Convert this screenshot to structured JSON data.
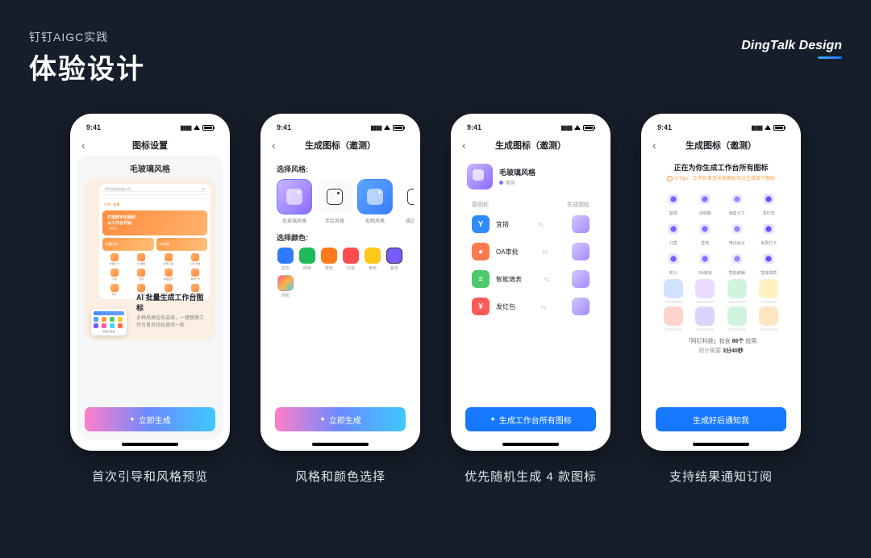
{
  "header": {
    "sub": "钉钉AIGC实践",
    "title": "体验设计"
  },
  "brand": {
    "name": "DingTalk Design"
  },
  "status_time": "9:41",
  "phone1": {
    "nav_title": "图标设置",
    "style_name": "毛玻璃风格",
    "company": "阿钉科技有限公司",
    "banner_line1": "打造数字化组织",
    "banner_line2": "从工作台开始",
    "banner_cta": "了解更多",
    "card_a": "专属红包",
    "card_b": "OA审批",
    "grid_items": [
      "考勤打卡",
      "OA审批",
      "智能人事",
      "钉钉文档",
      "订餐",
      "签到",
      "电话会议",
      "考勤打卡",
      "积分",
      "OA审批",
      "智能填报",
      "智能薪酬"
    ],
    "small_preview_label": "标准工作台",
    "info_title": "AI 批量生成工作台图标",
    "info_desc": "多种风格任你选择，一键替换工作台首页轻松焕然一新",
    "cta": "立即生成"
  },
  "phone2": {
    "nav_title": "生成图标（邀测）",
    "sec_style": "选择风格:",
    "styles": [
      {
        "name": "毛玻璃风格",
        "selected": true
      },
      {
        "name": "手绘风格"
      },
      {
        "name": "拟物风格"
      },
      {
        "name": "描边风格"
      }
    ],
    "sec_color": "选择颜色:",
    "colors": [
      {
        "name": "蓝色",
        "hex": "#2f7bff"
      },
      {
        "name": "绿色",
        "hex": "#1fba5a"
      },
      {
        "name": "橙色",
        "hex": "#ff7a1a"
      },
      {
        "name": "红色",
        "hex": "#ff4d4f"
      },
      {
        "name": "黄色",
        "hex": "#ffc718"
      },
      {
        "name": "紫色",
        "hex": "#7a5bff",
        "selected": true
      },
      {
        "name": "随机",
        "hex": "linear-gradient(135deg,#ff5fa2,#ffb23d,#3dd6ff)"
      }
    ],
    "cta": "立即生成"
  },
  "phone3": {
    "nav_title": "生成图标（邀测）",
    "style_name": "毛玻璃风格",
    "color_name": "紫色",
    "col_a": "原图标",
    "col_b": "生成图标",
    "rows": [
      {
        "label": "宜搭",
        "color": "#2f8bff",
        "glyph": "Y"
      },
      {
        "label": "OA审批",
        "color": "#ff7a4d",
        "glyph": "●"
      },
      {
        "label": "智能填表",
        "color": "#4ec96b",
        "glyph": "≡"
      },
      {
        "label": "发红包",
        "color": "#ff5a5a",
        "glyph": "¥"
      }
    ],
    "cta": "生成工作台所有图标"
  },
  "phone4": {
    "nav_title": "生成图标（邀测）",
    "heading": "正在为你生成工作台所有图标",
    "tip": "小Tips：工作台首页长按图标可以生成单个图标",
    "grid_icons": [
      {
        "label": "宜搭"
      },
      {
        "label": "请假期"
      },
      {
        "label": "销售分工"
      },
      {
        "label": "发红包"
      },
      {
        "label": "订盒"
      },
      {
        "label": "签到"
      },
      {
        "label": "电话会议"
      },
      {
        "label": "考勤打卡"
      },
      {
        "label": "积分"
      },
      {
        "label": "OA审批"
      },
      {
        "label": "智能薪酬"
      },
      {
        "label": "智能填表"
      }
    ],
    "placeholder_colors": [
      "#cfe3ff",
      "#e9dcff",
      "#d4f3df",
      "#fff1c2",
      "#ffd3c9",
      "#dcd4ff",
      "#d4f3df",
      "#ffe7c2"
    ],
    "summary_prefix": "「阿钉科技」包含 ",
    "summary_count": "86个",
    "summary_suffix": " 应用",
    "eta_label": "预计需要 ",
    "eta_value": "3分40秒",
    "cta": "生成好后通知我"
  },
  "captions": [
    "首次引导和风格预览",
    "风格和颜色选择",
    "优先随机生成 4 款图标",
    "支持结果通知订阅"
  ]
}
